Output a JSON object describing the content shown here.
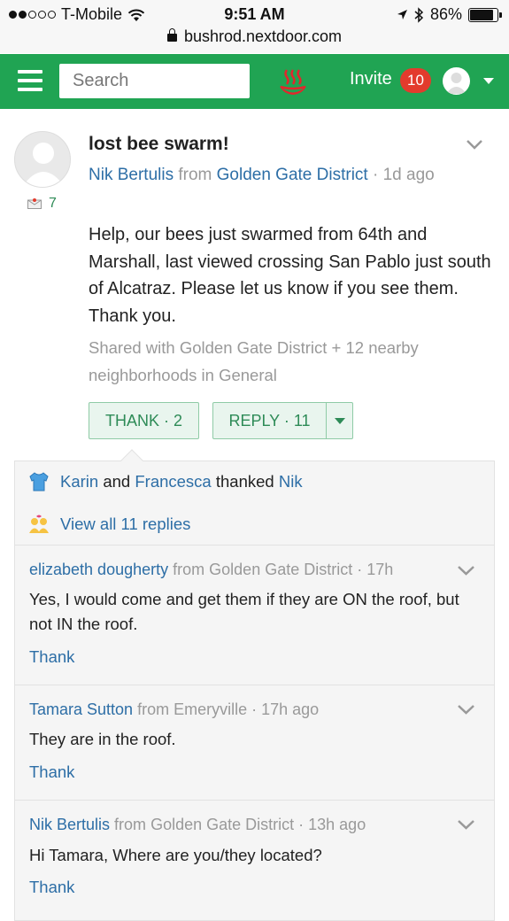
{
  "status_bar": {
    "carrier": "T-Mobile",
    "time": "9:51 AM",
    "battery": "86%",
    "battery_level": 0.86,
    "url": "bushrod.nextdoor.com"
  },
  "nav": {
    "search_placeholder": "Search",
    "invite_label": "Invite",
    "invite_count": "10",
    "accent": "#20a453"
  },
  "post": {
    "title": "lost bee swarm!",
    "author": "Nik Bertulis",
    "from_word": "from",
    "neighborhood": "Golden Gate District",
    "age": "· 1d ago",
    "private_message_count": "7",
    "body": "Help, our bees just swarmed from 64th and Marshall, last viewed crossing San Pablo just south of Alcatraz. Please let us know if you see them. Thank you.",
    "shared": "Shared with Golden Gate District + 12 nearby neighborhoods in General",
    "thank_button": "THANK",
    "thank_count": "· 2",
    "reply_button": "REPLY",
    "reply_count": "· 11"
  },
  "thanks_row": {
    "user1": "Karin",
    "and_word": "and",
    "user2": "Francesca",
    "thanked_word": "thanked",
    "target": "Nik"
  },
  "view_all": "View all 11 replies",
  "replies": [
    {
      "author": "elizabeth dougherty",
      "from_word": "from",
      "neighborhood": "Golden Gate District",
      "age": "· 17h",
      "text": "Yes, I would come and get them if they are ON the roof, but not IN the roof.",
      "thank_label": "Thank"
    },
    {
      "author": "Tamara Sutton",
      "from_word": "from",
      "neighborhood": "Emeryville",
      "age": "· 17h ago",
      "text": "They are in the roof.",
      "thank_label": "Thank"
    },
    {
      "author": "Nik Bertulis",
      "from_word": "from",
      "neighborhood": "Golden Gate District",
      "age": "· 13h ago",
      "text": "Hi Tamara, Where are you/they located?",
      "thank_label": "Thank"
    }
  ]
}
